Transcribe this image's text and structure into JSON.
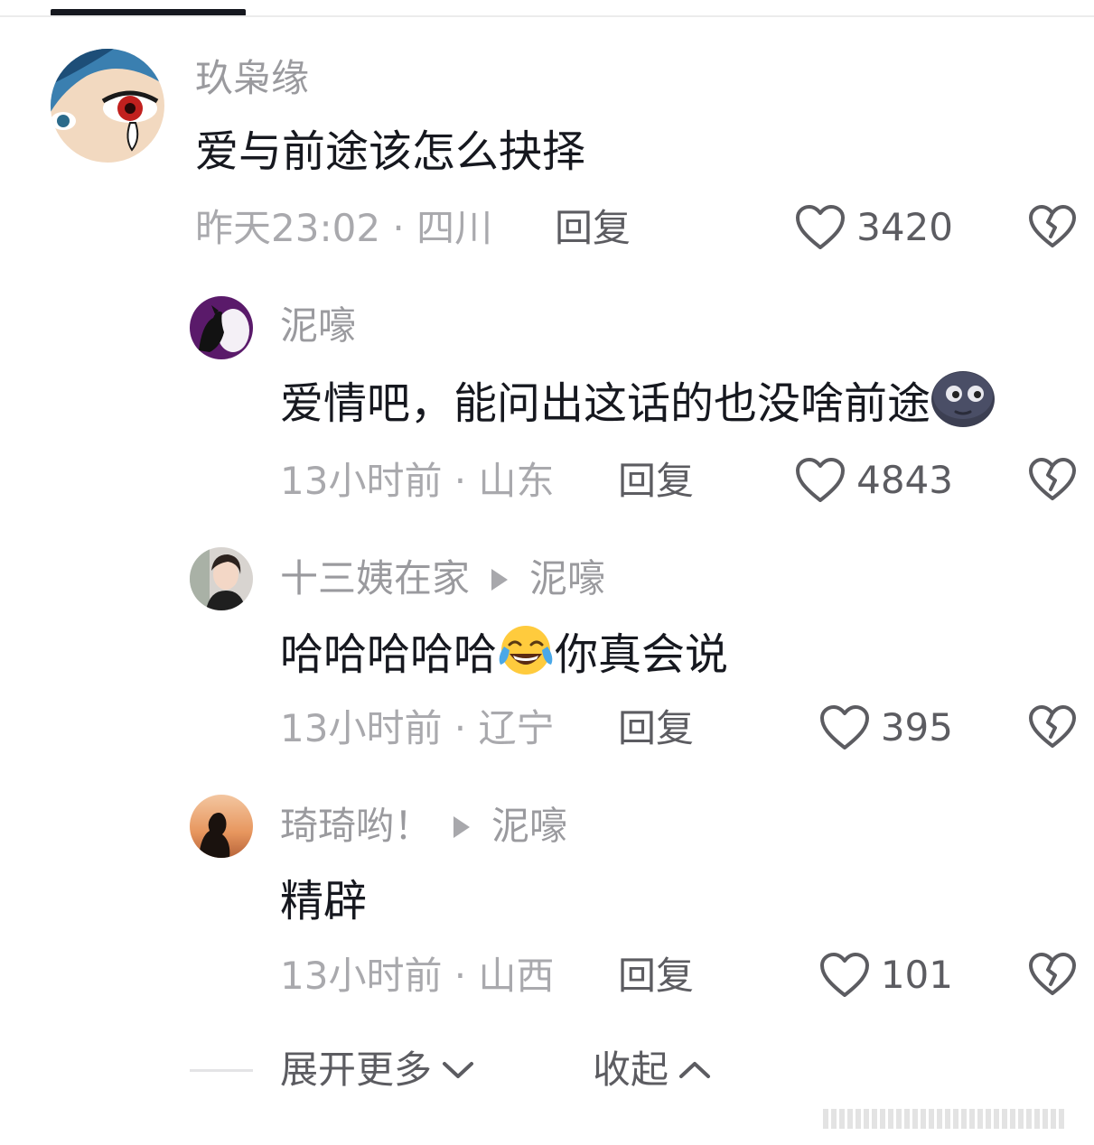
{
  "comments": [
    {
      "username": "玖枭缘",
      "reply_to": "",
      "content": "爱与前途该怎么抉择",
      "meta": "昨天23:02 · 四川",
      "reply_label": "回复",
      "likes": "3420"
    },
    {
      "username": "泥嚎",
      "reply_to": "",
      "content": "爱情吧，能问出这话的也没啥前途",
      "meta": "13小时前 · 山东",
      "reply_label": "回复",
      "likes": "4843"
    },
    {
      "username": "十三姨在家",
      "reply_to": "泥嚎",
      "content_before": "哈哈哈哈哈",
      "content_after": "你真会说",
      "meta": "13小时前 · 辽宁",
      "reply_label": "回复",
      "likes": "395"
    },
    {
      "username": "琦琦哟！",
      "reply_to": "泥嚎",
      "content": "精辟",
      "meta": "13小时前 · 山西",
      "reply_label": "回复",
      "likes": "101"
    }
  ],
  "footer": {
    "expand_label": "展开更多",
    "collapse_label": "收起"
  },
  "icons": {
    "like": "heart-outline-icon",
    "dislike": "broken-heart-icon",
    "reply_arrow": "triangle-right-icon",
    "expand": "chevron-down-icon",
    "collapse": "chevron-up-icon",
    "emoji_moon": "new-moon-face-emoji",
    "emoji_laugh": "tears-of-joy-emoji"
  },
  "colors": {
    "text_primary": "#16181f",
    "text_secondary": "#9a9a9e",
    "text_meta": "#a9a9ad",
    "text_action": "#5c5c61",
    "tab_indicator": "#16181f"
  }
}
